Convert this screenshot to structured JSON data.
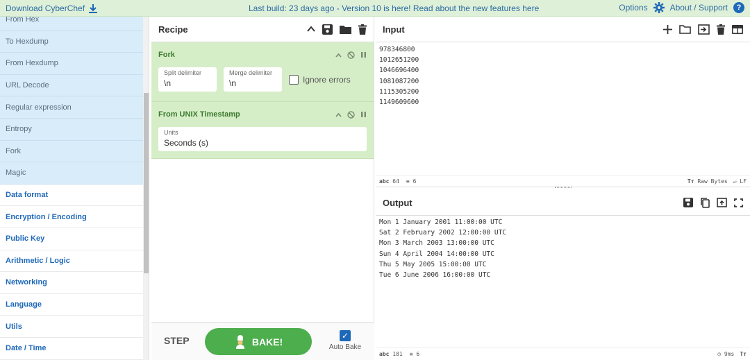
{
  "banner": {
    "download_label": "Download CyberChef",
    "center_text": "Last build: 23 days ago - Version 10 is here! Read about the new features here",
    "options_label": "Options",
    "about_label": "About / Support"
  },
  "ops": {
    "items": [
      "From Hex",
      "To Hexdump",
      "From Hexdump",
      "URL Decode",
      "Regular expression",
      "Entropy",
      "Fork",
      "Magic"
    ],
    "categories": [
      "Data format",
      "Encryption / Encoding",
      "Public Key",
      "Arithmetic / Logic",
      "Networking",
      "Language",
      "Utils",
      "Date / Time"
    ]
  },
  "recipe": {
    "title": "Recipe",
    "fork": {
      "title": "Fork",
      "split_label": "Split delimiter",
      "split_value": "\\n",
      "merge_label": "Merge delimiter",
      "merge_value": "\\n",
      "ignore_label": "Ignore errors"
    },
    "unix": {
      "title": "From UNIX Timestamp",
      "units_label": "Units",
      "units_value": "Seconds (s)"
    },
    "step_label": "STEP",
    "bake_label": "BAKE!",
    "autobake_label": "Auto Bake"
  },
  "input": {
    "title": "Input",
    "text": "978346800\n1012651200\n1046696400\n1081087200\n1115305200\n1149609600",
    "status_chars": "64",
    "status_lines": "6",
    "status_raw": "Raw Bytes",
    "status_eol": "LF"
  },
  "output": {
    "title": "Output",
    "text": "Mon 1 January 2001 11:00:00 UTC\nSat 2 February 2002 12:00:00 UTC\nMon 3 March 2003 13:00:00 UTC\nSun 4 April 2004 14:00:00 UTC\nThu 5 May 2005 15:00:00 UTC\nTue 6 June 2006 16:00:00 UTC",
    "status_chars": "181",
    "status_lines": "6",
    "status_time": "9ms"
  },
  "colors": {
    "accent": "#1e68b8",
    "bake": "#4cae4c",
    "recipe_op": "#d6eec8",
    "banner": "#dff0d8",
    "favorite_bg": "#d9ecf9"
  }
}
